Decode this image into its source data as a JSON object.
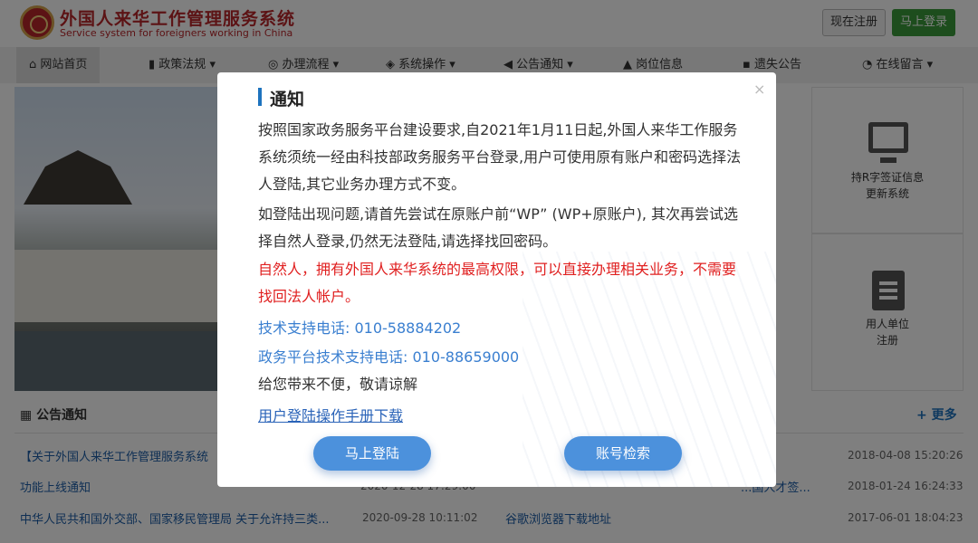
{
  "header": {
    "logo_cn": "外国人来华工作管理服务系统",
    "logo_en": "Service system for foreigners working in China",
    "register_label": "现在注册",
    "login_label": "马上登录"
  },
  "nav": {
    "items": [
      {
        "label": "网站首页",
        "icon": "home-icon"
      },
      {
        "label": "政策法规",
        "icon": "book-icon",
        "dropdown": true
      },
      {
        "label": "办理流程",
        "icon": "compass-icon",
        "dropdown": true
      },
      {
        "label": "系统操作",
        "icon": "layers-icon",
        "dropdown": true
      },
      {
        "label": "公告通知",
        "icon": "bullhorn-icon",
        "dropdown": true
      },
      {
        "label": "岗位信息",
        "icon": "sitemap-icon"
      },
      {
        "label": "遗失公告",
        "icon": "file-icon"
      },
      {
        "label": "在线留言",
        "icon": "comments-icon",
        "dropdown": true
      }
    ]
  },
  "tiles": {
    "r_visa": "持R字签证信息\n更新系统",
    "employer": "用人单位\n注册"
  },
  "announcements": {
    "title": "公告通知",
    "more": "更多",
    "left": [
      {
        "title": "【关于外国人来华工作管理服务系统",
        "date": ""
      },
      {
        "title": "功能上线通知",
        "date": "2020-12-28 17:29:00"
      },
      {
        "title": "中华人民共和国外交部、国家移民管理局 关于允许持三类...",
        "date": "2020-09-28 10:11:02"
      }
    ],
    "right": [
      {
        "title": "",
        "date": "2018-04-08 15:20:26"
      },
      {
        "title": "...国人才签...",
        "date": "2018-01-24 16:24:33"
      },
      {
        "title": "谷歌浏览器下载地址",
        "date": "2017-06-01 18:04:23"
      }
    ]
  },
  "modal": {
    "title": "通知",
    "close": "×",
    "p1": "按照国家政务服务平台建设要求,自2021年1月11日起,外国人来华工作服务系统须统一经由科技部政务服务平台登录,用户可使用原有账户和密码选择法人登陆,其它业务办理方式不变。",
    "p2": "如登陆出现问题,请首先尝试在原账户前“WP” (WP+原账户), 其次再尝试选择自然人登录,仍然无法登陆,请选择找回密码。",
    "p3": "自然人，拥有外国人来华系统的最高权限，可以直接办理相关业务，不需要找回法人帐户。",
    "tech_support": "技术支持电话: 010-58884202",
    "platform_support": "政务平台技术支持电话: 010-88659000",
    "apology": "给您带来不便，敬请谅解",
    "manual_link": "用户登陆操作手册下载",
    "login_button": "马上登陆",
    "account_search_button": "账号检索"
  },
  "colors": {
    "brand_red": "#b8262a",
    "accent_blue": "#4c91dc",
    "login_green": "#3a9b3a",
    "notice_red": "#e02020"
  }
}
